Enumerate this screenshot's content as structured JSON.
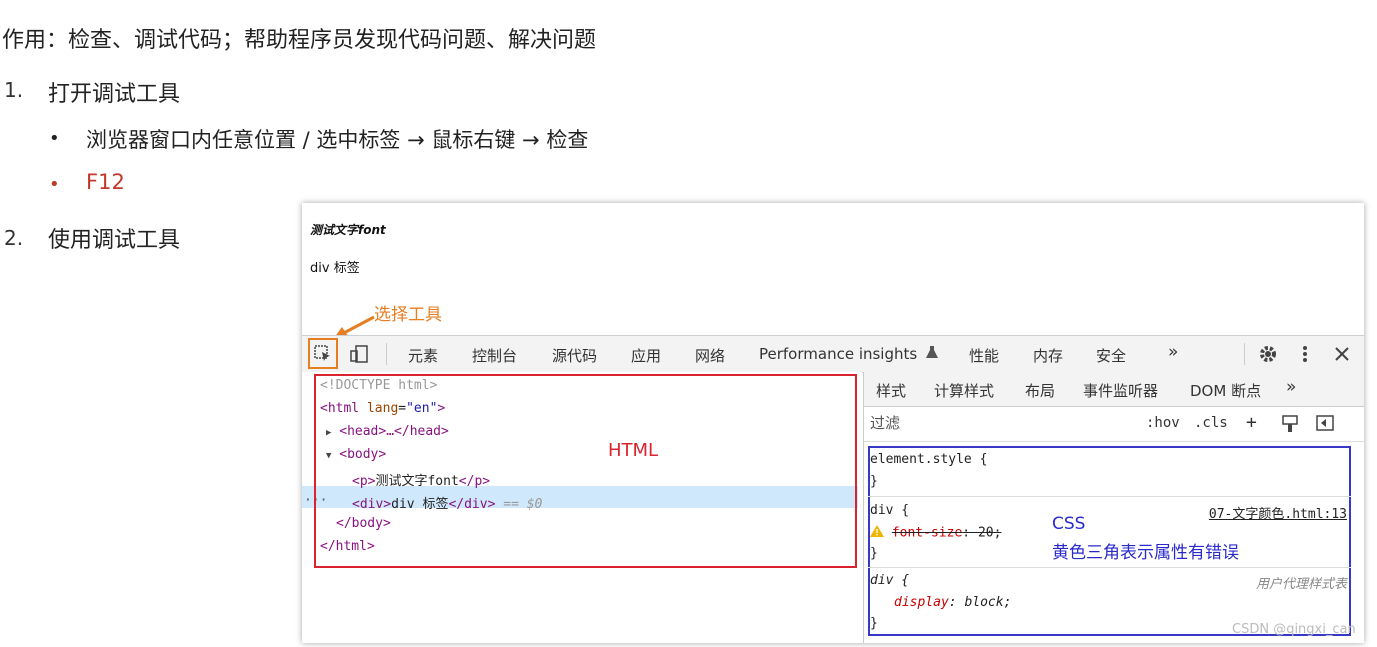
{
  "slide": {
    "purpose": "作用：检查、调试代码；帮助程序员发现代码问题、解决问题",
    "step1_num": "1.",
    "step1_text": "打开调试工具",
    "bullet1": "浏览器窗口内任意位置 / 选中标签 → 鼠标右键 → 检查",
    "bullet2": "F12",
    "step2_num": "2.",
    "step2_text": "使用调试工具",
    "bullet_char": "•"
  },
  "page_preview": {
    "p_text": "测试文字font",
    "div_text": "div 标签"
  },
  "annotations": {
    "select_tool": "选择工具",
    "html": "HTML",
    "css": "CSS",
    "css_note": "黄色三角表示属性有错误"
  },
  "devtools": {
    "tabs": [
      "元素",
      "控制台",
      "源代码",
      "应用",
      "网络",
      "Performance insights",
      "性能",
      "内存",
      "安全"
    ],
    "more": "»",
    "elements": {
      "doctype": "<!DOCTYPE html>",
      "html_open_tag": "<html",
      "html_attr_name": "lang",
      "html_attr_value": "\"en\"",
      "head": "<head>…</head>",
      "body_open": "<body>",
      "p_line_open": "<p>",
      "p_line_text": "测试文字font",
      "p_line_close": "</p>",
      "div_open": "<div>",
      "div_text": "div 标签",
      "div_close": "</div>",
      "div_suffix": "== $0",
      "body_close": "</body>",
      "html_close": "</html>",
      "row_dots": "···"
    },
    "styles": {
      "tabs": [
        "样式",
        "计算样式",
        "布局",
        "事件监听器",
        "DOM 断点"
      ],
      "more": "»",
      "filter_placeholder": "过滤",
      "hov": ":hov",
      "cls": ".cls",
      "plus": "+",
      "element_style": "element.style {",
      "close_brace": "}",
      "rule1_selector": "div {",
      "rule1_source": "07-文字颜色.html:13",
      "rule1_prop": "font-size",
      "rule1_value": "20",
      "rule2_selector": "div {",
      "rule2_source": "用户代理样式表",
      "rule2_prop": "display",
      "rule2_value": "block"
    }
  },
  "watermark": "CSDN @qingxi_can",
  "colors": {
    "annotation_orange": "#e67e22",
    "html_box_red": "#d9232f",
    "css_box_blue": "#3838c8",
    "bullet_red": "#c0392b",
    "selection_blue": "#cfe8fc"
  },
  "icons": [
    "inspect-icon",
    "device-toggle-icon",
    "flask-icon",
    "gear-icon",
    "kebab-menu-icon",
    "close-icon",
    "warning-icon",
    "paint-icon",
    "sidebar-toggle-icon"
  ]
}
